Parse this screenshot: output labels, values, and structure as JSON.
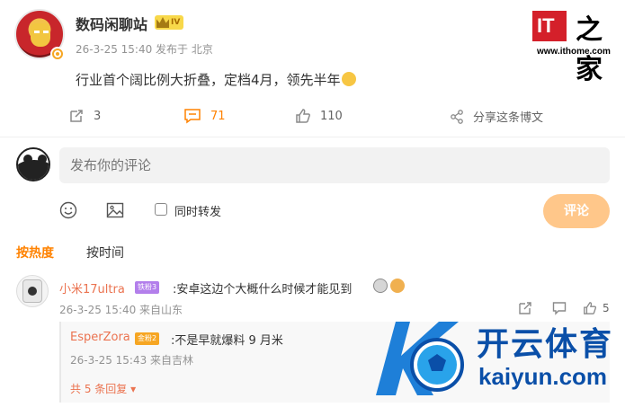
{
  "post": {
    "username": "数码闲聊站",
    "level": "IV",
    "meta": "26-3-25 15:40  发布于 北京",
    "text": "行业首个阔比例大折叠，定档4月，领先半年"
  },
  "watermark": {
    "it": "IT",
    "zhi": "之家",
    "url": "www.ithome.com"
  },
  "actions": {
    "repost_count": "3",
    "comment_count": "71",
    "like_count": "110",
    "share_label": "分享这条博文"
  },
  "comment_box": {
    "placeholder": "发布你的评论",
    "repost_label": "同时转发",
    "submit_label": "评论"
  },
  "sort": {
    "hot_label": "按热度",
    "time_label": "按时间"
  },
  "comments": [
    {
      "username": "小米17ultra",
      "badge": "铁粉3",
      "text": ":安卓这边个大概什么时候才能见到",
      "meta": "26-3-25 15:40  来自山东",
      "like_count": "5",
      "reply": {
        "username": "EsperZora",
        "badge": "金粉2",
        "text": ":不是早就爆料 9 月米",
        "meta": "26-3-25 15:43  来自吉林"
      },
      "more_replies": "共 5 条回复"
    }
  ],
  "overlay": {
    "cn": "开云体育",
    "en": "kaiyun.com"
  },
  "colors": {
    "accent": "#ff8200",
    "username_link": "#eb7350",
    "submit_disabled": "#ffc78a",
    "brand_red": "#d4202a",
    "kaiyun_blue": "#0a4fa8"
  }
}
